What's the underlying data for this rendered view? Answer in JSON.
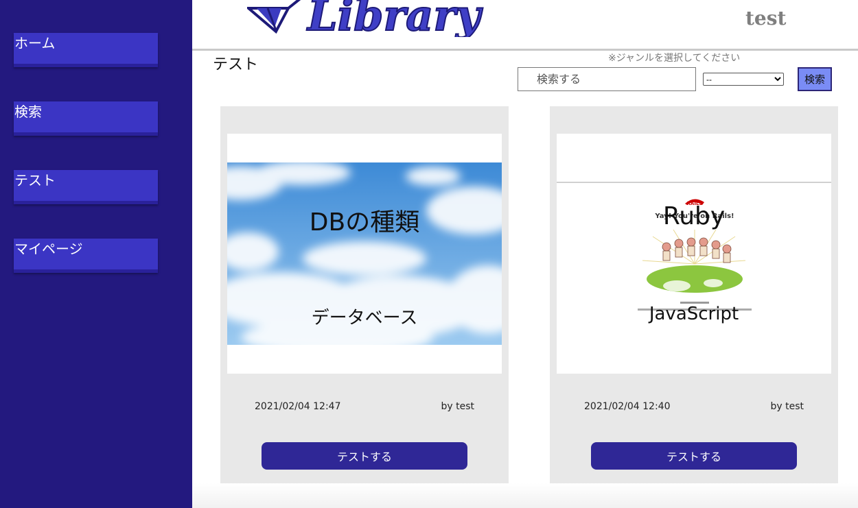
{
  "app": {
    "logo_text": "Library",
    "username": "test"
  },
  "sidebar": {
    "items": [
      {
        "label": "ホーム"
      },
      {
        "label": "検索"
      },
      {
        "label": "テスト"
      },
      {
        "label": "マイページ"
      }
    ]
  },
  "header": {
    "page_title": "テスト"
  },
  "search": {
    "genre_note": "※ジャンルを選択してください",
    "placeholder": "検索する",
    "value": "",
    "genre_selected": "--",
    "button_label": "検索"
  },
  "posts": [
    {
      "title": "DBの種類",
      "subtitle": "データベース",
      "date": "2021/02/04 12:47",
      "author": "by test",
      "button_label": "テストする",
      "image": "sky-clouds"
    },
    {
      "title": "Ruby",
      "subtitle": "JavaScript",
      "date": "2021/02/04 12:40",
      "author": "by test",
      "button_label": "テストする",
      "image": "rails-welcome",
      "image_texts": {
        "badge": "RAILS",
        "heading": "Yay! You're on Rails!"
      }
    }
  ],
  "colors": {
    "sidebar": "#23197f",
    "nav_item": "#3b35c4",
    "button": "#2f2796",
    "search_button": "#7a8cf5",
    "card": "#e8e8e8"
  }
}
